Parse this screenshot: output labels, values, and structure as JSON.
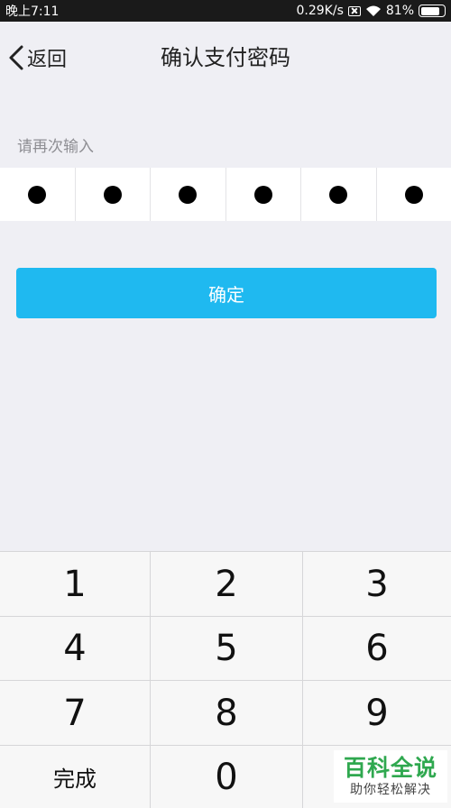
{
  "status_bar": {
    "time": "晚上7:11",
    "network_speed": "0.29K/s",
    "battery_percent": "81%",
    "battery_level": 0.81
  },
  "nav": {
    "back_label": "返回",
    "title": "确认支付密码"
  },
  "form": {
    "hint": "请再次输入",
    "pin_length": 6,
    "pin_filled": 6
  },
  "confirm_button": {
    "label": "确定"
  },
  "keypad": {
    "keys": [
      "1",
      "2",
      "3",
      "4",
      "5",
      "6",
      "7",
      "8",
      "9",
      "完成",
      "0",
      ""
    ]
  },
  "watermark": {
    "main": "百科全说",
    "sub": "助你轻松解决"
  },
  "colors": {
    "accent": "#1fb9f0",
    "background": "#efeff4",
    "watermark_green": "#2fa84f"
  }
}
